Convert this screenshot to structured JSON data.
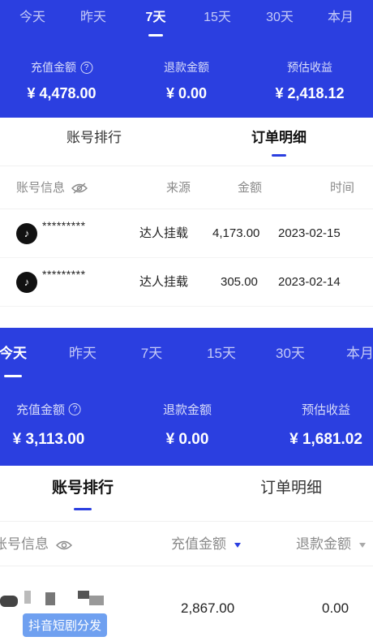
{
  "top": {
    "tabs": [
      "今天",
      "昨天",
      "7天",
      "15天",
      "30天",
      "本月"
    ],
    "active_tab": "7天",
    "stats": {
      "recharge": {
        "label": "充值金额",
        "value": "¥ 4,478.00"
      },
      "refund": {
        "label": "退款金额",
        "value": "¥ 0.00"
      },
      "estimated": {
        "label": "预估收益",
        "value": "¥ 2,418.12"
      }
    },
    "subtabs": {
      "account_rank": "账号排行",
      "order_detail": "订单明细"
    },
    "active_subtab": "订单明细",
    "columns": {
      "account": "账号信息",
      "source": "来源",
      "amount": "金额",
      "time": "时间"
    },
    "rows": [
      {
        "account": "*********",
        "source": "达人挂载",
        "amount": "4,173.00",
        "time": "2023-02-15"
      },
      {
        "account": "*********",
        "source": "达人挂载",
        "amount": "305.00",
        "time": "2023-02-14"
      }
    ]
  },
  "bottom": {
    "tabs": [
      "今天",
      "昨天",
      "7天",
      "15天",
      "30天",
      "本月"
    ],
    "active_tab": "今天",
    "stats": {
      "recharge": {
        "label": "充值金额",
        "value": "¥ 3,113.00"
      },
      "refund": {
        "label": "退款金额",
        "value": "¥ 0.00"
      },
      "estimated": {
        "label": "预估收益",
        "value": "¥ 1,681.02"
      }
    },
    "subtabs": {
      "account_rank": "账号排行",
      "order_detail": "订单明细"
    },
    "active_subtab": "账号排行",
    "columns": {
      "account": "账号信息",
      "recharge": "充值金额",
      "refund": "退款金额"
    },
    "rows": [
      {
        "tag": "抖音短剧分发",
        "recharge": "2,867.00",
        "refund": "0.00"
      }
    ]
  },
  "colors": {
    "brand_blue": "#2b3fe0",
    "tag_blue": "#6fa0f0"
  }
}
